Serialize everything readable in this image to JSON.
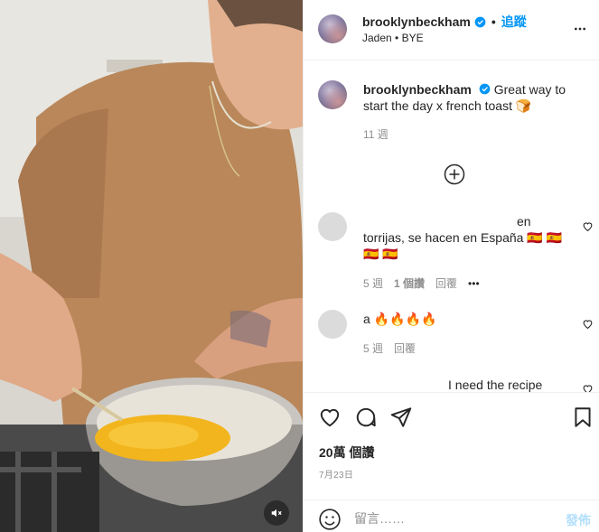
{
  "header": {
    "username": "brooklynbeckham",
    "follow_label": "追蹤",
    "sub_label": "Jaden • BYE",
    "verified_icon": "verified-badge-icon",
    "more_icon": "more-options-icon"
  },
  "caption": {
    "username": "brooklynbeckham",
    "text": "Great way to start the day x french toast 🍞",
    "age": "11 週"
  },
  "load_more_icon": "plus-circle-icon",
  "comments": [
    {
      "text_top": "en",
      "text": "torrijas, se hacen en España 🇪🇸 🇪🇸 🇪🇸 🇪🇸",
      "age": "5 週",
      "likes": "1 個讚",
      "reply": "回覆",
      "more": "•••"
    },
    {
      "text": "a 🔥🔥🔥🔥",
      "age": "5 週",
      "reply": "回覆"
    },
    {
      "text": "I need the recipe"
    }
  ],
  "actions": {
    "like_icon": "heart-icon",
    "comment_icon": "comment-icon",
    "share_icon": "send-icon",
    "save_icon": "bookmark-icon",
    "likes_count": "20萬 個讚",
    "date": "7月23日"
  },
  "comment_box": {
    "emoji_icon": "emoji-icon",
    "placeholder": "留言……",
    "post_label": "發佈"
  },
  "media": {
    "mute_icon": "muted-speaker-icon"
  },
  "colors": {
    "accent": "#0095f6",
    "post_disabled": "#b2dffc",
    "secondary_text": "#8e8e8e",
    "border": "#efefef"
  }
}
